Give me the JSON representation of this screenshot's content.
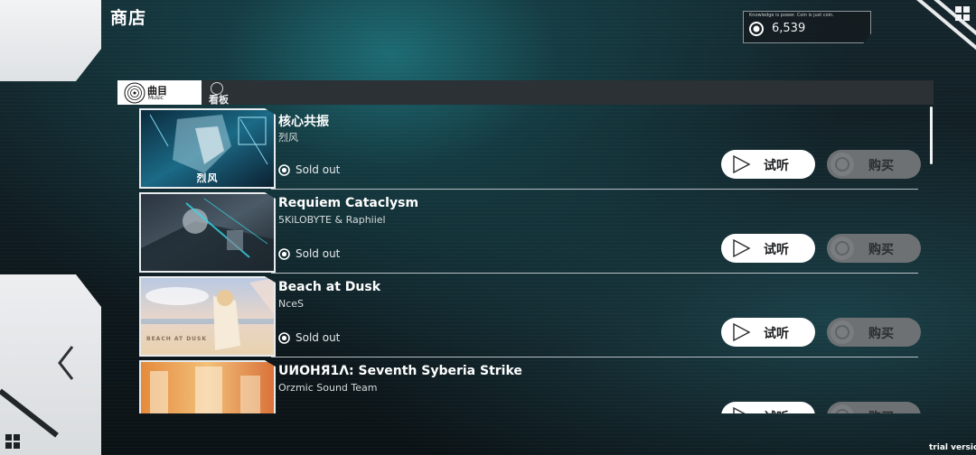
{
  "header": {
    "title": "商店",
    "coin_motto": "Knowledge is power. Coin is just coin.",
    "coin_amount": "6,539"
  },
  "tabs": [
    {
      "label": "曲目",
      "sublabel": "Music",
      "active": true
    },
    {
      "label": "看板",
      "active": false
    }
  ],
  "songs": [
    {
      "title": "核心共振",
      "artist": "烈风",
      "status": "Sold out",
      "jacket_text": "烈风",
      "listen_label": "试听",
      "buy_label": "购买"
    },
    {
      "title": "Requiem Cataclysm",
      "artist": "5KiLOBYTE & Raphiiel",
      "status": "Sold out",
      "jacket_text": "",
      "listen_label": "试听",
      "buy_label": "购买"
    },
    {
      "title": "Beach at Dusk",
      "artist": "NceS",
      "status": "Sold out",
      "jacket_text": "BEACH AT DUSK",
      "listen_label": "试听",
      "buy_label": "购买"
    },
    {
      "title": "UИOHЯ1Λ: Seventh Syberia Strike",
      "artist": "Orzmic Sound Team",
      "status": "",
      "jacket_text": "",
      "listen_label": "试听",
      "buy_label": "购买"
    }
  ],
  "footer": {
    "trial_label": "trial version"
  },
  "icons": {
    "back": "chevron-left-icon",
    "menu": "grid-icon",
    "coin": "coin-icon",
    "play": "play-icon",
    "sold": "check-circle-icon"
  },
  "colors": {
    "accent_white": "#ffffff",
    "buy_disabled": "#6d7174",
    "panel": "#2b3134"
  }
}
